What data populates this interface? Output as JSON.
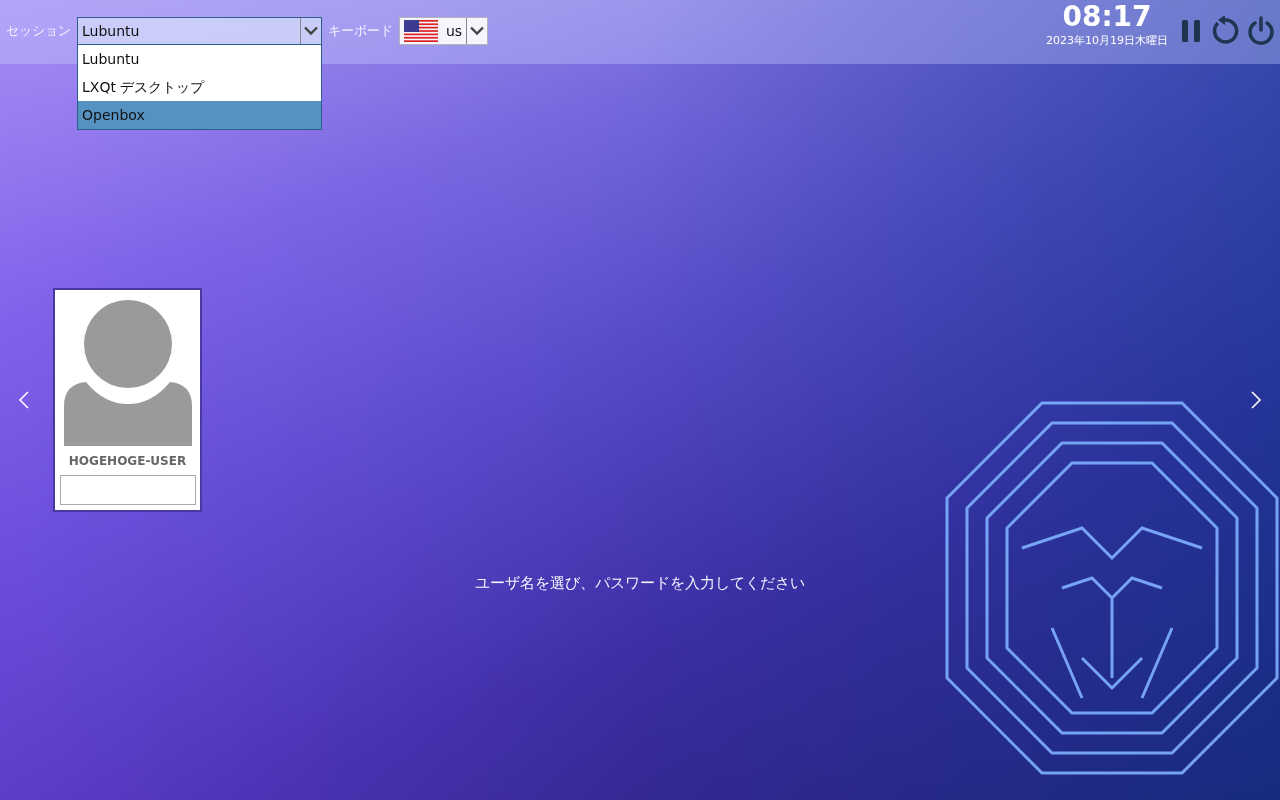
{
  "top_bar": {
    "session_label": "セッション",
    "session": {
      "value": "Lubuntu",
      "expanded": true,
      "options": [
        {
          "label": "Lubuntu",
          "highlighted": false
        },
        {
          "label": "LXQt デスクトップ",
          "highlighted": false
        },
        {
          "label": "Openbox",
          "highlighted": true
        }
      ]
    },
    "keyboard_label": "キーボード",
    "keyboard": {
      "value": "us"
    },
    "clock": {
      "time": "08:17",
      "date": "2023年10月19日木曜日"
    }
  },
  "users": [
    {
      "name": "HOGEHOGE-USER"
    }
  ],
  "prompt": "ユーザ名を選び、パスワードを入力してください"
}
